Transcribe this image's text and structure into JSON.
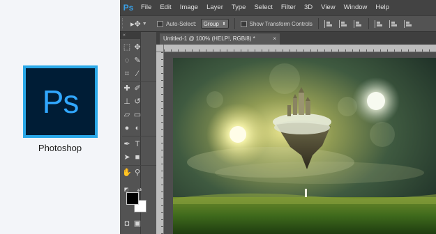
{
  "promo": {
    "logo_text": "Ps",
    "caption": "Photoshop",
    "logo_border_color": "#2aa8e8",
    "logo_bg_color": "#001d36",
    "logo_text_color": "#31a8ff"
  },
  "app": {
    "badge": "Ps",
    "menu": [
      "File",
      "Edit",
      "Image",
      "Layer",
      "Type",
      "Select",
      "Filter",
      "3D",
      "View",
      "Window",
      "Help"
    ],
    "options": {
      "tool_icon": "move-tool-icon",
      "auto_select_label": "Auto-Select:",
      "auto_select_value": "Group",
      "show_transform_label": "Show Transform Controls"
    },
    "panel_collapse_glyph": "«",
    "document": {
      "tab_title": "Untitled-1 @ 100% (HELP!, RGB/8) *",
      "close_glyph": "×"
    },
    "tools": [
      "marquee-tool-icon",
      "move-tool-icon",
      "lasso-tool-icon",
      "quick-selection-tool-icon",
      "crop-tool-icon",
      "eyedropper-tool-icon",
      "healing-brush-tool-icon",
      "brush-tool-icon",
      "clone-stamp-tool-icon",
      "history-brush-tool-icon",
      "eraser-tool-icon",
      "gradient-tool-icon",
      "blur-tool-icon",
      "dodge-tool-icon",
      "pen-tool-icon",
      "type-tool-icon",
      "path-selection-tool-icon",
      "rectangle-tool-icon",
      "hand-tool-icon",
      "zoom-tool-icon",
      "quick-mask-icon",
      "screen-mode-icon"
    ],
    "colors": {
      "foreground": "#000000",
      "background": "#ffffff"
    }
  }
}
